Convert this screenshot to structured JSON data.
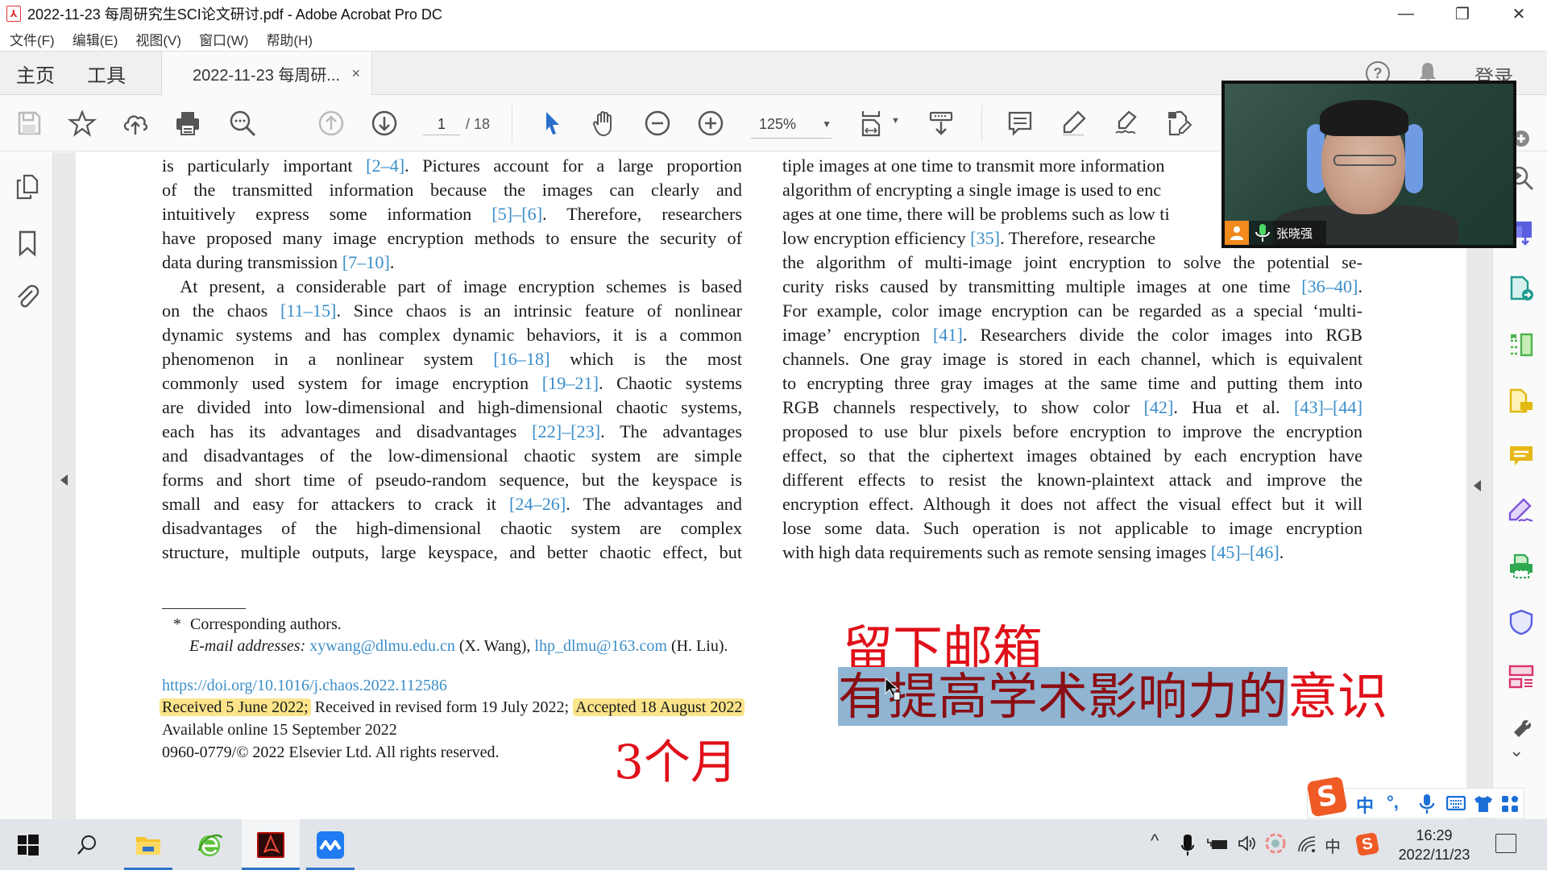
{
  "window": {
    "title": "2022-11-23 每周研究生SCI论文研讨.pdf - Adobe Acrobat Pro DC",
    "controls": {
      "minimize": "—",
      "restore": "❐",
      "close": "✕"
    }
  },
  "menu": [
    "文件(F)",
    "编辑(E)",
    "视图(V)",
    "窗口(W)",
    "帮助(H)"
  ],
  "tabs": {
    "home": "主页",
    "tools": "工具",
    "document": "2022-11-23 每周研...",
    "close": "×",
    "help": "?",
    "sign_in": "登录"
  },
  "toolbar": {
    "icons": [
      "save-icon",
      "bookmark-star-icon",
      "upload-cloud-icon",
      "print-icon",
      "search-icon",
      "prev-page-icon",
      "next-page-icon",
      "select-cursor-icon",
      "hand-icon",
      "zoom-out-icon",
      "zoom-in-icon",
      "fit-page-icon",
      "scroll-mode-icon",
      "comment-icon",
      "highlight-icon",
      "sign-icon",
      "edit-pdf-icon"
    ],
    "page_current": "1",
    "page_total": "/ 18",
    "zoom": "125%"
  },
  "document": {
    "left_column": [
      [
        {
          "t": "is particularly important "
        },
        {
          "r": "[2–4]"
        },
        {
          "t": ". Pictures account for a large proportion"
        }
      ],
      [
        {
          "t": "of the transmitted information because the images can clearly and"
        }
      ],
      [
        {
          "t": "intuitively express some information "
        },
        {
          "r": "[5]–[6]"
        },
        {
          "t": ". Therefore, researchers"
        }
      ],
      [
        {
          "t": "have proposed many image encryption methods to ensure the security of"
        }
      ],
      [
        {
          "t": "data during transmission "
        },
        {
          "r": "[7–10]"
        },
        {
          "t": "."
        }
      ],
      [
        {
          "t": " At present, a considerable part of image encryption schemes is based"
        }
      ],
      [
        {
          "t": "on the chaos "
        },
        {
          "r": "[11–15]"
        },
        {
          "t": ". Since chaos is an intrinsic feature of nonlinear"
        }
      ],
      [
        {
          "t": "dynamic systems and has complex dynamic behaviors, it is a common"
        }
      ],
      [
        {
          "t": "phenomenon in a nonlinear system "
        },
        {
          "r": "[16–18]"
        },
        {
          "t": " which is the most"
        }
      ],
      [
        {
          "t": "commonly used system for image encryption "
        },
        {
          "r": "[19–21]"
        },
        {
          "t": ". Chaotic systems"
        }
      ],
      [
        {
          "t": "are divided into low-dimensional and high-dimensional chaotic systems,"
        }
      ],
      [
        {
          "t": "each has its advantages and disadvantages "
        },
        {
          "r": "[22]–[23]"
        },
        {
          "t": ". The advantages"
        }
      ],
      [
        {
          "t": "and disadvantages of the low-dimensional chaotic system are simple"
        }
      ],
      [
        {
          "t": "forms and short time of pseudo-random sequence, but the keyspace is"
        }
      ],
      [
        {
          "t": "small and easy for attackers to crack it "
        },
        {
          "r": "[24–26]"
        },
        {
          "t": ". The advantages and"
        }
      ],
      [
        {
          "t": "disadvantages of the high-dimensional chaotic system are complex"
        }
      ],
      [
        {
          "t": "structure, multiple outputs, large keyspace, and better chaotic effect, but"
        }
      ]
    ],
    "right_column": [
      [
        {
          "t": "tiple images at one time to transmit more information"
        }
      ],
      [
        {
          "t": "algorithm of encrypting a single image is used to enc"
        }
      ],
      [
        {
          "t": "ages at one time, there will be problems such as low ti"
        }
      ],
      [
        {
          "t": "low encryption efficiency "
        },
        {
          "r": "[35]"
        },
        {
          "t": ". Therefore, researche"
        }
      ],
      [
        {
          "t": "the algorithm of multi-image joint encryption to solve the potential se-"
        }
      ],
      [
        {
          "t": "curity risks caused by transmitting multiple images at one time "
        },
        {
          "r": "[36–40]"
        },
        {
          "t": "."
        }
      ],
      [
        {
          "t": "For example, color image encryption can be regarded as a special ‘multi-"
        }
      ],
      [
        {
          "t": "image’ encryption "
        },
        {
          "r": "[41]"
        },
        {
          "t": ". Researchers divide the color images into RGB"
        }
      ],
      [
        {
          "t": "channels. One gray image is stored in each channel, which is equivalent"
        }
      ],
      [
        {
          "t": "to encrypting three gray images at the same time and putting them into"
        }
      ],
      [
        {
          "t": "RGB channels respectively, to show color "
        },
        {
          "r": "[42]"
        },
        {
          "t": ". Hua et al. "
        },
        {
          "r": "[43]–[44]"
        }
      ],
      [
        {
          "t": "proposed to use blur pixels before encryption to improve the encryption"
        }
      ],
      [
        {
          "t": "effect, so that the ciphertext images obtained by each encryption have"
        }
      ],
      [
        {
          "t": "different effects to resist the known-plaintext attack and improve the"
        }
      ],
      [
        {
          "t": "encryption effect. Although it does not affect the visual effect but it will"
        }
      ],
      [
        {
          "t": "lose some data. Such operation is not applicable to image encryption"
        }
      ],
      [
        {
          "t": "with high data requirements such as remote sensing images "
        },
        {
          "r": "[45]–[46]"
        },
        {
          "t": "."
        }
      ]
    ],
    "footnote": {
      "star": "*",
      "corresponding": "Corresponding authors.",
      "email_label": "E-mail addresses:",
      "email1": "xywang@dlmu.edu.cn",
      "email1_name": "(X. Wang),",
      "email2": "lhp_dlmu@163.com",
      "email2_name": "(H. Liu).",
      "doi": "https://doi.org/10.1016/j.chaos.2022.112586",
      "received": "Received 5 June 2022;",
      "revised": "Received in revised form 19 July 2022;",
      "accepted": "Accepted 18 August 2022",
      "available": "Available online 15 September 2022",
      "copyright": "0960-0779/© 2022 Elsevier Ltd. All rights reserved."
    },
    "annotations": {
      "leave_email": "留下邮箱",
      "awareness_selected": "有提高学术影响力的",
      "awareness_rest": "意识",
      "three_months": "3个月"
    },
    "highlight_color": "#fbe48a",
    "link_color": "#3b8ec9",
    "annotation_color": "#e0101a"
  },
  "video": {
    "participant_name": "张晓强"
  },
  "right_tools": [
    "export-pdf-icon",
    "organize-pages-icon",
    "create-pdf-icon",
    "comment-tool-icon",
    "fill-sign-icon",
    "print-production-icon",
    "protect-icon",
    "forms-icon",
    "more-tools-icon"
  ],
  "ime": {
    "logo": "S",
    "mode": "中",
    "punct": "°,",
    "items": [
      "mic-icon",
      "keyboard-icon",
      "skin-icon",
      "toolbox-icon"
    ]
  },
  "taskbar": {
    "apps": [
      "start-icon",
      "search-icon",
      "file-explorer-icon",
      "browser-icon",
      "acrobat-icon",
      "meeting-app-icon"
    ],
    "tray_ime": "中",
    "time": "16:29",
    "date": "2022/11/23"
  }
}
